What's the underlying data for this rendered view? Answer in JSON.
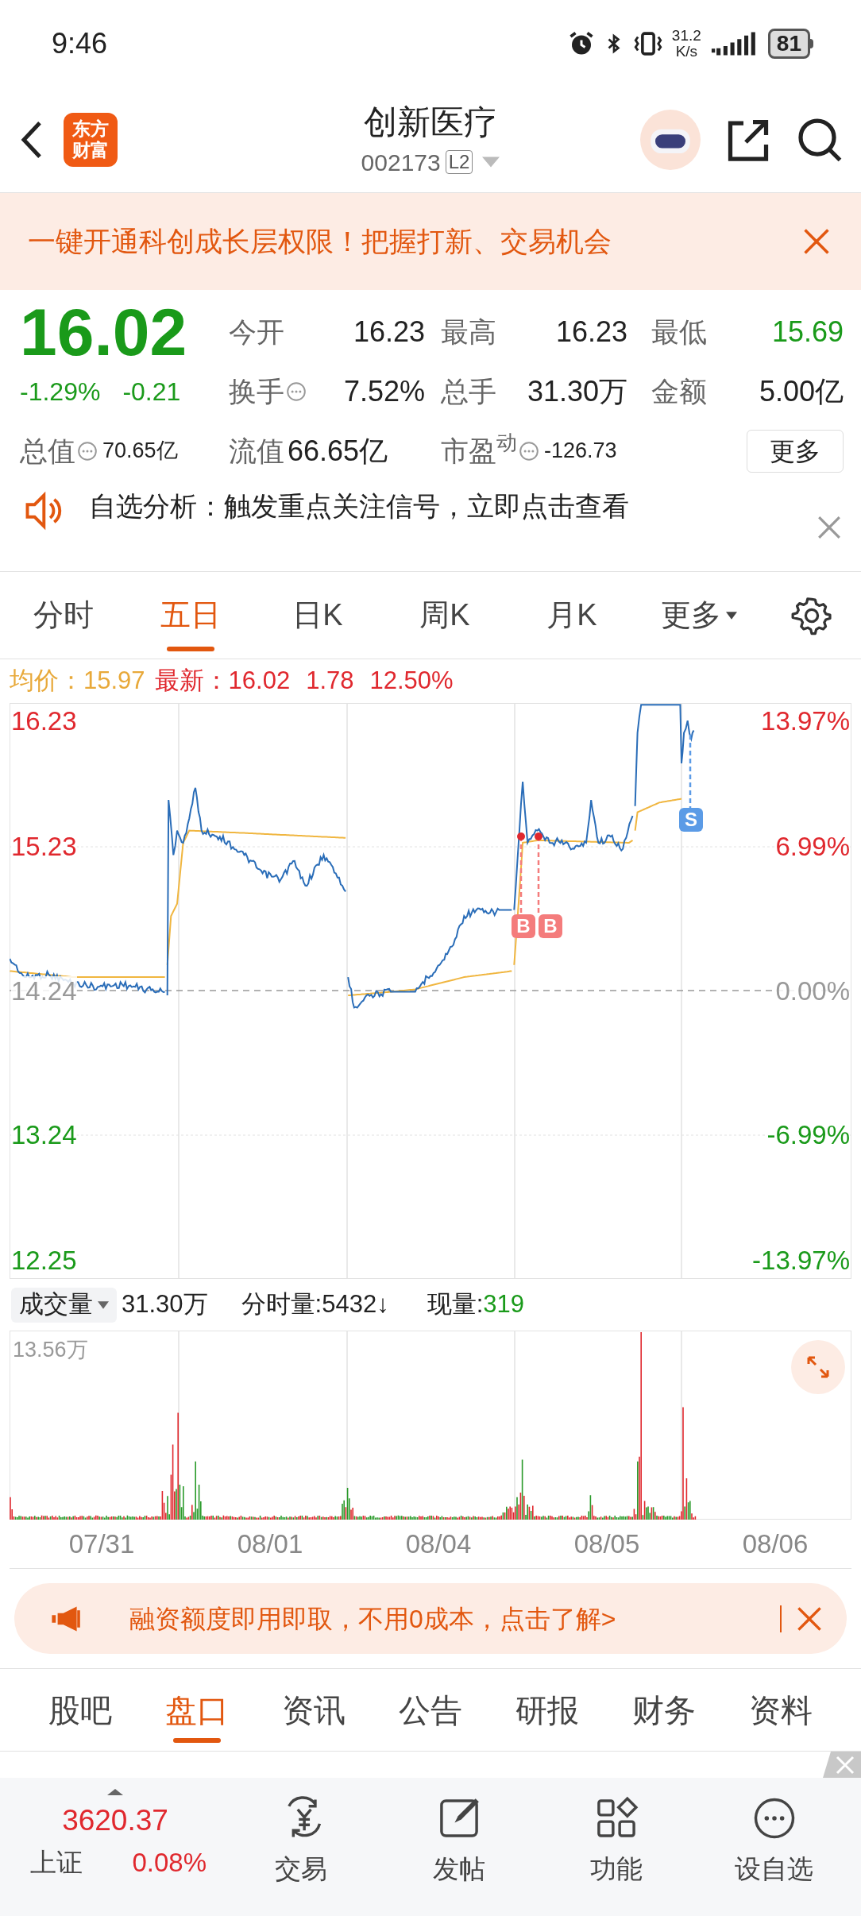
{
  "status_bar": {
    "time": "9:46",
    "net_speed": "31.2",
    "net_speed_unit": "K/s",
    "battery": "81"
  },
  "header": {
    "logo_lines": [
      "东方",
      "财富"
    ],
    "title": "创新医疗",
    "code": "002173",
    "level_badge": "L2"
  },
  "banner": {
    "text": "一键开通科创成长层权限！把握打新、交易机会"
  },
  "quote": {
    "price": "16.02",
    "change_pct": "-1.29%",
    "change": "-0.21",
    "color": "#1a9a1a",
    "stats": [
      {
        "label": "今开",
        "value": "16.23",
        "info": false,
        "kind": "regular",
        "color": "#222222"
      },
      {
        "label": "最高",
        "value": "16.23",
        "info": false,
        "kind": "regular",
        "color": "#222222"
      },
      {
        "label": "最低",
        "value": "15.69",
        "info": false,
        "kind": "regular",
        "color": "#1a9a1a"
      },
      {
        "label": "换手",
        "value": "7.52%",
        "info": true,
        "kind": "regular",
        "color": "#222222"
      },
      {
        "label": "总手",
        "value": "31.30万",
        "info": false,
        "kind": "regular",
        "color": "#222222"
      },
      {
        "label": "金额",
        "value": "5.00亿",
        "info": false,
        "kind": "regular",
        "color": "#222222"
      },
      {
        "label": "总值",
        "value": "70.65亿",
        "info": true,
        "kind": "compact",
        "color": "#222222"
      },
      {
        "label": "流值",
        "value": "66.65亿",
        "info": false,
        "kind": "regular",
        "color": "#222222"
      },
      {
        "label": "市盈$^{动}$",
        "value": "-126.73",
        "info": true,
        "kind": "compact",
        "color": "#222222"
      }
    ],
    "more_button": "更多"
  },
  "notice": {
    "text": "自选分析：触发重点关注信号，立即点击查看"
  },
  "chart_tabs": [
    {
      "label": "分时",
      "selected": false,
      "dropdown": false
    },
    {
      "label": "五日",
      "selected": true,
      "dropdown": false
    },
    {
      "label": "日K",
      "selected": false,
      "dropdown": false
    },
    {
      "label": "周K",
      "selected": false,
      "dropdown": false
    },
    {
      "label": "月K",
      "selected": false,
      "dropdown": false
    },
    {
      "label": "更多",
      "selected": false,
      "dropdown": true
    }
  ],
  "legend": {
    "avg_label": "均价：",
    "avg": "15.97",
    "latest_label": "最新：",
    "latest": "16.02",
    "change": "1.78",
    "change_pct": "12.50%"
  },
  "price_axis": [
    {
      "price": "16.23",
      "pct": "13.97%",
      "color": "#e0282e"
    },
    {
      "price": "15.23",
      "pct": "6.99%",
      "color": "#e0282e"
    },
    {
      "price": "14.24",
      "pct": "0.00%",
      "color": "#999999"
    },
    {
      "price": "13.24",
      "pct": "-6.99%",
      "color": "#1a9a1a"
    },
    {
      "price": "12.25",
      "pct": "-13.97%",
      "color": "#1a9a1a"
    }
  ],
  "trade_marks": [
    {
      "label": "B",
      "kind": "buy"
    },
    {
      "label": "B",
      "kind": "buy"
    },
    {
      "label": "S",
      "kind": "sell"
    }
  ],
  "volume": {
    "selector": "成交量",
    "total": "31.30万",
    "minute": "分时量:5432↓",
    "current_label": "现量:",
    "current": "319",
    "max": "13.56万"
  },
  "dates": [
    "07/31",
    "08/01",
    "08/04",
    "08/05",
    "08/06"
  ],
  "promo": {
    "text": "融资额度即用即取，不用0成本，点击了解>"
  },
  "bottom_tabs": [
    {
      "label": "股吧",
      "selected": false
    },
    {
      "label": "盘口",
      "selected": true
    },
    {
      "label": "资讯",
      "selected": false
    },
    {
      "label": "公告",
      "selected": false
    },
    {
      "label": "研报",
      "selected": false
    },
    {
      "label": "财务",
      "selected": false
    },
    {
      "label": "资料",
      "selected": false
    }
  ],
  "index_ticker": {
    "value": "3620.37",
    "name": "上证",
    "change": "0.08%"
  },
  "actions": [
    {
      "label": "交易",
      "kind": "trade"
    },
    {
      "label": "发帖",
      "kind": "post"
    },
    {
      "label": "功能",
      "kind": "apps"
    },
    {
      "label": "设自选",
      "kind": "more"
    }
  ]
}
